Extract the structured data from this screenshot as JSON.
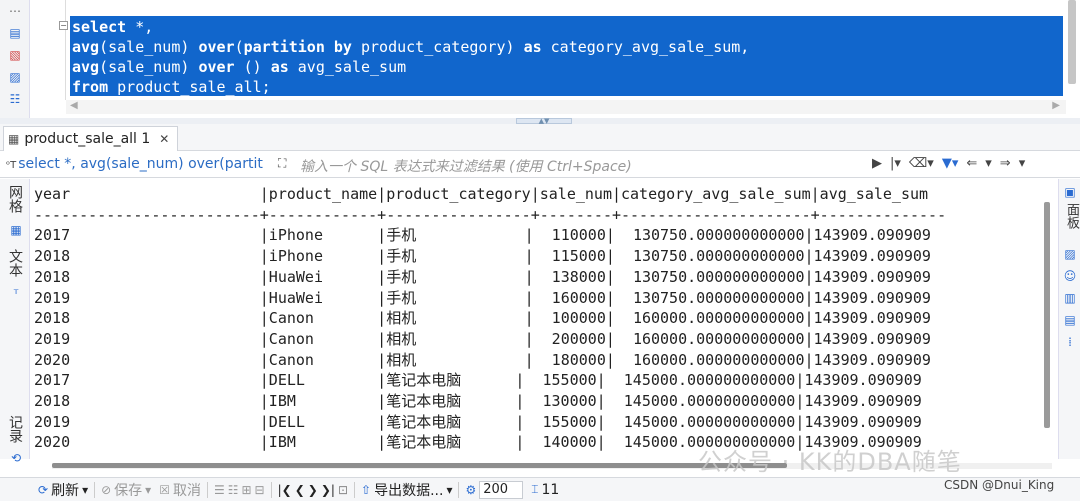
{
  "editor": {
    "lines": [
      {
        "kw": "select",
        "rest": " *,"
      },
      {
        "kw": "avg",
        "rest": "(sale_num) ",
        "kw2": "over",
        "rest2": "(",
        "kw3": "partition by",
        "rest3": " product_category) ",
        "kw4": "as",
        "rest4": " category_avg_sale_sum,"
      },
      {
        "kw": "avg",
        "rest": "(sale_num) ",
        "kw2": "over",
        "rest2": " () ",
        "kw3": "as",
        "rest3": " avg_sale_sum"
      },
      {
        "kw": "from",
        "rest": " product_sale_all;"
      }
    ],
    "fold_glyph": "⊖"
  },
  "result_tab": {
    "label": "product_sale_all 1",
    "close": "✕"
  },
  "filter": {
    "query_preview": "select *, avg(sale_num) over(partit",
    "placeholder": "输入一个 SQL 表达式来过滤结果 (使用 Ctrl+Space)"
  },
  "side_tabs": {
    "grid": "网格",
    "text": "文本",
    "record": "记录"
  },
  "right_tabs": {
    "panel": "面板"
  },
  "result_text": [
    "year                     |product_name|product_category|sale_num|category_avg_sale_sum|avg_sale_sum",
    "-------------------------+------------+----------------+--------+---------------------+--------------",
    "2017                     |iPhone      |手机            |  110000|  130750.000000000000|143909.090909",
    "2018                     |iPhone      |手机            |  115000|  130750.000000000000|143909.090909",
    "2018                     |HuaWei      |手机            |  138000|  130750.000000000000|143909.090909",
    "2019                     |HuaWei      |手机            |  160000|  130750.000000000000|143909.090909",
    "2018                     |Canon       |相机            |  100000|  160000.000000000000|143909.090909",
    "2019                     |Canon       |相机            |  200000|  160000.000000000000|143909.090909",
    "2020                     |Canon       |相机            |  180000|  160000.000000000000|143909.090909",
    "2017                     |DELL        |笔记本电脑      |  155000|  145000.000000000000|143909.090909",
    "2018                     |IBM         |笔记本电脑      |  130000|  145000.000000000000|143909.090909",
    "2019                     |DELL        |笔记本电脑      |  155000|  145000.000000000000|143909.090909",
    "2020                     |IBM         |笔记本电脑      |  140000|  145000.000000000000|143909.090909"
  ],
  "bottom": {
    "refresh": "刷新",
    "save": "保存",
    "cancel": "取消",
    "export": "导出数据...",
    "fetch_size": "200",
    "row_count": "11"
  },
  "watermark": "公众号 · KK的DBA随笔",
  "credit": "CSDN @Dnui_King",
  "colors": {
    "selection": "#1166cc",
    "accent": "#2a6bd1"
  }
}
